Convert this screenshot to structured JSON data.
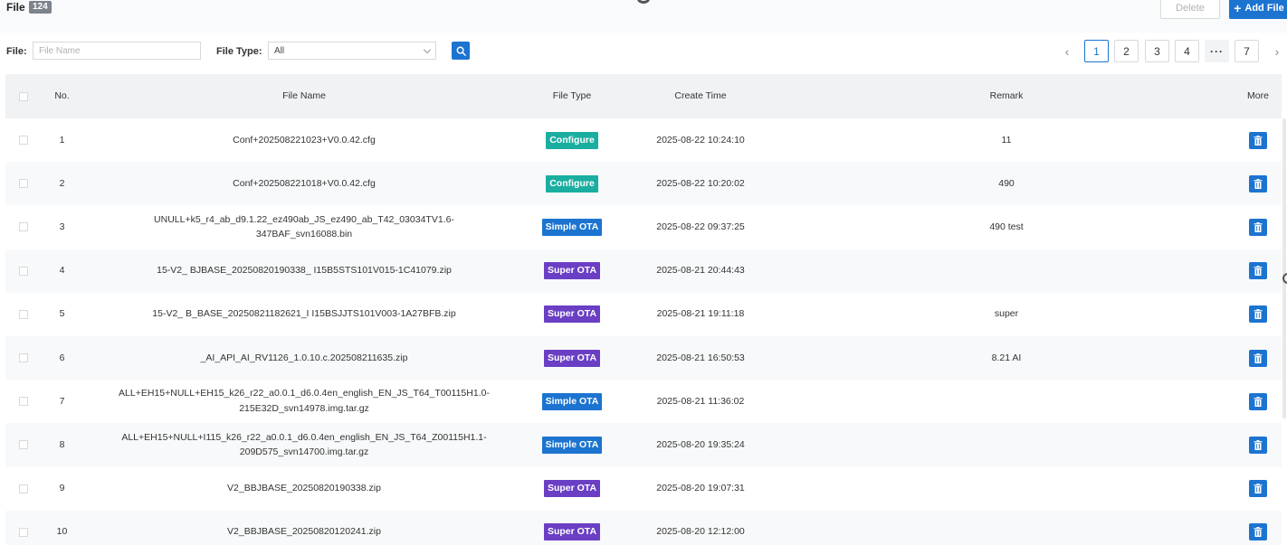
{
  "header": {
    "title": "File",
    "count": "124",
    "delete_label": "Delete",
    "add_label": "Add File",
    "add_icon": "+"
  },
  "filters": {
    "file_label": "File:",
    "file_placeholder": "File Name",
    "file_value": "",
    "type_label": "File Type:",
    "type_value": "All"
  },
  "pagination": {
    "prev": "‹",
    "pages": [
      "1",
      "2",
      "3",
      "4"
    ],
    "ellipsis": "···",
    "last": "7",
    "next": "›",
    "current": "1"
  },
  "table": {
    "columns": [
      "No.",
      "File Name",
      "File Type",
      "Create Time",
      "Remark",
      "More"
    ],
    "rows": [
      {
        "no": "1",
        "name": "Conf+202508221023+V0.0.42.cfg",
        "type": "Configure",
        "time": "2025-08-22 10:24:10",
        "remark": "11"
      },
      {
        "no": "2",
        "name": "Conf+202508221018+V0.0.42.cfg",
        "type": "Configure",
        "time": "2025-08-22 10:20:02",
        "remark": "490"
      },
      {
        "no": "3",
        "name": "UNULL+k5_r4_ab_d9.1.22_ez490ab_JS_ez490_ab_T42_03034TV1.6-347BAF_svn16088.bin",
        "type": "Simple OTA",
        "time": "2025-08-22 09:37:25",
        "remark": "490 test"
      },
      {
        "no": "4",
        "name": "15-V2_ BJBASE_20250820190338_ I15B5STS101V015-1C41079.zip",
        "type": "Super OTA",
        "time": "2025-08-21 20:44:43",
        "remark": ""
      },
      {
        "no": "5",
        "name": "15-V2_ B_BASE_20250821182621_I I15BSJJTS101V003-1A27BFB.zip",
        "type": "Super OTA",
        "time": "2025-08-21 19:11:18",
        "remark": "super"
      },
      {
        "no": "6",
        "name": "_AI_API_AI_RV1126_1.0.10.c.202508211635.zip",
        "type": "Super OTA",
        "time": "2025-08-21 16:50:53",
        "remark": "8.21 AI"
      },
      {
        "no": "7",
        "name": "ALL+EH15+NULL+EH15_k26_r22_a0.0.1_d6.0.4en_english_EN_JS_T64_T00115H1.0-215E32D_svn14978.img.tar.gz",
        "type": "Simple OTA",
        "time": "2025-08-21 11:36:02",
        "remark": ""
      },
      {
        "no": "8",
        "name": "ALL+EH15+NULL+I115_k26_r22_a0.0.1_d6.0.4en_english_EN_JS_T64_Z00115H1.1-209D575_svn14700.img.tar.gz",
        "type": "Simple OTA",
        "time": "2025-08-20 19:35:24",
        "remark": ""
      },
      {
        "no": "9",
        "name": "V2_BBJBASE_20250820190338.zip",
        "type": "Super OTA",
        "time": "2025-08-20 19:07:31",
        "remark": ""
      },
      {
        "no": "10",
        "name": "V2_BBJBASE_20250820120241.zip",
        "type": "Super OTA",
        "time": "2025-08-20 12:12:00",
        "remark": ""
      }
    ]
  },
  "colors": {
    "primary": "#1c74d0",
    "configure": "#1aaea0",
    "simple_ota": "#1c74d0",
    "super_ota": "#6a3fc4"
  },
  "icons": {
    "search": "search-icon",
    "trash": "trash-icon"
  }
}
